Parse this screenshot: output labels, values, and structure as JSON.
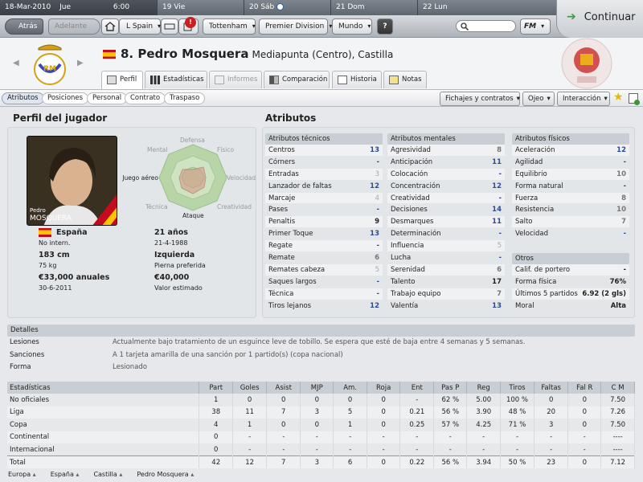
{
  "datebar": {
    "current_date": "18-Mar-2010",
    "current_day": "Jue",
    "current_time": "6:00",
    "days": [
      {
        "num": "19",
        "name": "Vie"
      },
      {
        "num": "20",
        "name": "Sáb"
      },
      {
        "num": "21",
        "name": "Dom"
      },
      {
        "num": "22",
        "name": "Lun"
      }
    ]
  },
  "nav": {
    "back": "Atrás",
    "forward": "Adelante",
    "league": "L Spain",
    "club": "Tottenham",
    "competition": "Premier Division",
    "world": "Mundo",
    "help": "?",
    "fm": "FM",
    "continue": "Continuar",
    "notification_count": "!"
  },
  "player": {
    "number_name": "8. Pedro Mosquera",
    "position": "Mediapunta (Centro), Castilla",
    "photo_first": "Pedro",
    "photo_last": "MOSQUERA"
  },
  "tabs": [
    "Perfil",
    "Estadísticas",
    "Informes",
    "Comparación",
    "Historia",
    "Notas"
  ],
  "subtabs": [
    "Atributos",
    "Posiciones",
    "Personal",
    "Contrato",
    "Traspaso"
  ],
  "actions": {
    "contracts": "Fichajes y contratos",
    "scout": "Ojeo",
    "interaction": "Interacción"
  },
  "profile": {
    "title": "Perfil del jugador",
    "radar_labels": [
      "Defensa",
      "Físico",
      "Velocidad",
      "Creatividad",
      "Ataque",
      "Técnica",
      "Juego aéreo",
      "Mental"
    ],
    "nationality": "España",
    "intl": "No intern.",
    "age": "21 años",
    "dob": "21-4-1988",
    "height": "183 cm",
    "weight": "75 kg",
    "foot": "Izquierda",
    "foot_label": "Pierna preferida",
    "wage": "€33,000 anuales",
    "contract_end": "30-6-2011",
    "value": "€40,000",
    "value_label": "Valor estimado"
  },
  "attributes": {
    "title": "Atributos",
    "technical": {
      "title": "Atributos técnicos",
      "rows": [
        {
          "name": "Centros",
          "val": "13",
          "c": "hi"
        },
        {
          "name": "Córners",
          "val": "-",
          "c": "hi"
        },
        {
          "name": "Entradas",
          "val": "3",
          "c": "lo"
        },
        {
          "name": "Lanzador de faltas",
          "val": "12",
          "c": "hi"
        },
        {
          "name": "Marcaje",
          "val": "4",
          "c": "lo"
        },
        {
          "name": "Pases",
          "val": "-",
          "c": "hi"
        },
        {
          "name": "Penaltis",
          "val": "9",
          "c": "dk"
        },
        {
          "name": "Primer Toque",
          "val": "13",
          "c": "hi"
        },
        {
          "name": "Regate",
          "val": "-",
          "c": "hi"
        },
        {
          "name": "Remate",
          "val": "6",
          "c": ""
        },
        {
          "name": "Remates cabeza",
          "val": "5",
          "c": "lo"
        },
        {
          "name": "Saques largos",
          "val": "-",
          "c": "hi"
        },
        {
          "name": "Técnica",
          "val": "-",
          "c": "hi"
        },
        {
          "name": "Tiros lejanos",
          "val": "12",
          "c": "hi"
        }
      ]
    },
    "mental": {
      "title": "Atributos mentales",
      "rows": [
        {
          "name": "Agresividad",
          "val": "8",
          "c": ""
        },
        {
          "name": "Anticipación",
          "val": "11",
          "c": "hi"
        },
        {
          "name": "Colocación",
          "val": "-",
          "c": "hi"
        },
        {
          "name": "Concentración",
          "val": "12",
          "c": "hi"
        },
        {
          "name": "Creatividad",
          "val": "-",
          "c": "hi"
        },
        {
          "name": "Decisiones",
          "val": "14",
          "c": "hi"
        },
        {
          "name": "Desmarques",
          "val": "11",
          "c": "hi"
        },
        {
          "name": "Determinación",
          "val": "-",
          "c": "hi"
        },
        {
          "name": "Influencia",
          "val": "5",
          "c": "lo"
        },
        {
          "name": "Lucha",
          "val": "-",
          "c": "hi"
        },
        {
          "name": "Serenidad",
          "val": "6",
          "c": ""
        },
        {
          "name": "Talento",
          "val": "17",
          "c": "dk"
        },
        {
          "name": "Trabajo equipo",
          "val": "7",
          "c": ""
        },
        {
          "name": "Valentía",
          "val": "13",
          "c": "hi"
        }
      ]
    },
    "physical": {
      "title": "Atributos físicos",
      "rows": [
        {
          "name": "Aceleración",
          "val": "12",
          "c": "hi"
        },
        {
          "name": "Agilidad",
          "val": "-",
          "c": "hi"
        },
        {
          "name": "Equilibrio",
          "val": "10",
          "c": ""
        },
        {
          "name": "Forma natural",
          "val": "-",
          "c": "hi"
        },
        {
          "name": "Fuerza",
          "val": "8",
          "c": ""
        },
        {
          "name": "Resistencia",
          "val": "10",
          "c": ""
        },
        {
          "name": "Salto",
          "val": "7",
          "c": ""
        },
        {
          "name": "Velocidad",
          "val": "-",
          "c": "hi"
        }
      ]
    },
    "otros": {
      "title": "Otros",
      "rows": [
        {
          "name": "Calif. de portero",
          "val": "-",
          "c": "dk"
        },
        {
          "name": "Forma física",
          "val": "76%",
          "c": "dk"
        },
        {
          "name": "Últimos 5 partidos",
          "val": "6.92 (2 gls)",
          "c": "dk"
        },
        {
          "name": "Moral",
          "val": "Alta",
          "c": "dk"
        }
      ]
    }
  },
  "detalles": {
    "title": "Detalles",
    "rows": [
      {
        "k": "Lesiones",
        "v": "Actualmente bajo tratamiento de un esguince leve de tobillo. Se espera que esté de baja entre 4 semanas y 5 semanas."
      },
      {
        "k": "Sanciones",
        "v": "A 1 tarjeta amarilla de una sanción por 1 partido(s) (copa nacional)"
      },
      {
        "k": "Forma",
        "v": "Lesionado"
      }
    ]
  },
  "stats": {
    "headers": [
      "Estadísticas",
      "Part",
      "Goles",
      "Asist",
      "MJP",
      "Am.",
      "Roja",
      "Ent",
      "Pas P",
      "Reg",
      "Tiros",
      "Faltas",
      "Fal R",
      "C M"
    ],
    "rows": [
      [
        "No oficiales",
        "1",
        "0",
        "0",
        "0",
        "0",
        "0",
        "-",
        "62 %",
        "5.00",
        "100 %",
        "0",
        "0",
        "7.50"
      ],
      [
        "Liga",
        "38",
        "11",
        "7",
        "3",
        "5",
        "0",
        "0.21",
        "56 %",
        "3.90",
        "48 %",
        "20",
        "0",
        "7.26"
      ],
      [
        "Copa",
        "4",
        "1",
        "0",
        "0",
        "1",
        "0",
        "0.25",
        "57 %",
        "4.25",
        "71 %",
        "3",
        "0",
        "7.50"
      ],
      [
        "Continental",
        "0",
        "-",
        "-",
        "-",
        "-",
        "-",
        "-",
        "-",
        "-",
        "-",
        "-",
        "-",
        "----"
      ],
      [
        "Internacional",
        "0",
        "-",
        "-",
        "-",
        "-",
        "-",
        "-",
        "-",
        "-",
        "-",
        "-",
        "-",
        "----"
      ],
      [
        "Total",
        "42",
        "12",
        "7",
        "3",
        "6",
        "0",
        "0.22",
        "56 %",
        "3.94",
        "50 %",
        "23",
        "0",
        "7.12"
      ]
    ]
  },
  "footer": [
    "Europa",
    "España",
    "Castilla",
    "Pedro Mosquera"
  ]
}
